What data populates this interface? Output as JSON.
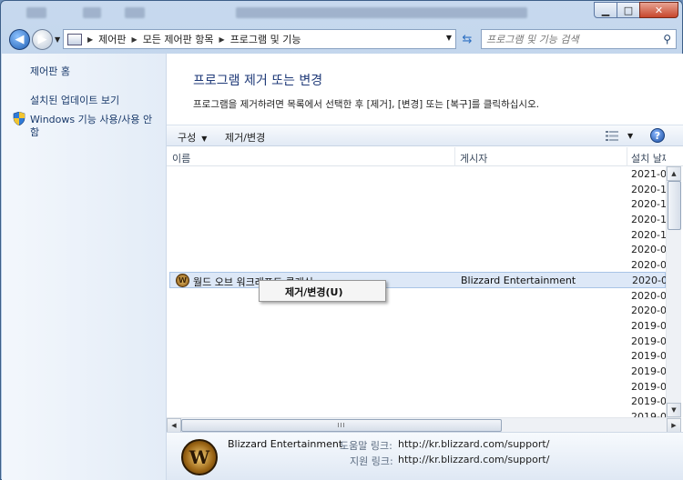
{
  "window": {
    "caption": {
      "minimize": "▁",
      "maximize": "□",
      "close": "✕"
    }
  },
  "navbar": {
    "breadcrumb": [
      "제어판",
      "모든 제어판 항목",
      "프로그램 및 기능"
    ],
    "search_placeholder": "프로그램 및 기능 검색"
  },
  "sidebar": {
    "items": [
      {
        "label": "제어판 홈"
      },
      {
        "label": "설치된 업데이트 보기"
      },
      {
        "label": "Windows 기능 사용/사용 안"
      },
      {
        "label": "함"
      }
    ]
  },
  "main": {
    "title": "프로그램 제거 또는 변경",
    "description": "프로그램을 제거하려면 목록에서 선택한 후 [제거], [변경] 또는 [복구]를 클릭하십시오."
  },
  "toolbar": {
    "organize_label": "구성",
    "uninstall_change_label": "제거/변경"
  },
  "columns": {
    "name": "이름",
    "publisher": "게시자",
    "installed_on": "설치 날짜"
  },
  "rows": {
    "install_dates": [
      "2021-0",
      "2020-1",
      "2020-1",
      "2020-1",
      "2020-1",
      "2020-0",
      "2020-0",
      "2020-0",
      "2020-0",
      "2020-0",
      "2019-0",
      "2019-0",
      "2019-0",
      "2019-0",
      "2019-0",
      "2019-0",
      "2019-0"
    ],
    "selected": {
      "name": "월드 오브 워크래프트 클래식",
      "publisher": "Blizzard Entertainment"
    }
  },
  "context_menu": {
    "item": "제거/변경(U)"
  },
  "details": {
    "publisher": "Blizzard Entertainment",
    "help_link_label": "도움말 링크:",
    "help_link": "http://kr.blizzard.com/support/",
    "support_link_label": "지원 링크:",
    "support_link": "http://kr.blizzard.com/support/"
  },
  "scroll": {
    "grip": "III"
  }
}
